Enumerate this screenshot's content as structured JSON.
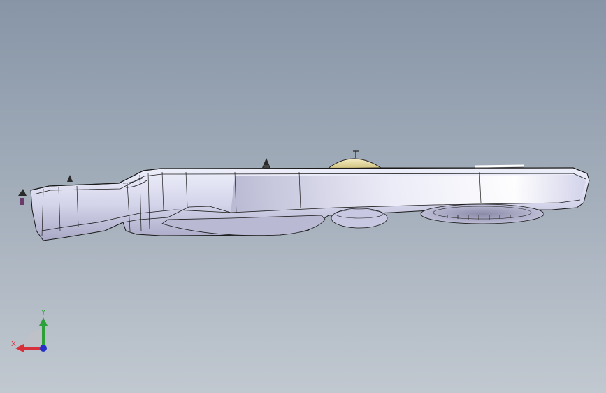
{
  "viewport": {
    "name": "graphics-area",
    "background_top": "#8795a7",
    "background_bottom": "#c1c8d0"
  },
  "model": {
    "name": "street-light-housing",
    "body_color": "#d6d6ec",
    "highlight_color": "#f4f4fc",
    "edge_color": "#1a1a1a",
    "dome_color": "#e9dba0"
  },
  "triad": {
    "x_label": "X",
    "y_label": "Y",
    "x_color": "#d8303a",
    "y_color": "#2ea03a",
    "z_color": "#2431c8"
  }
}
